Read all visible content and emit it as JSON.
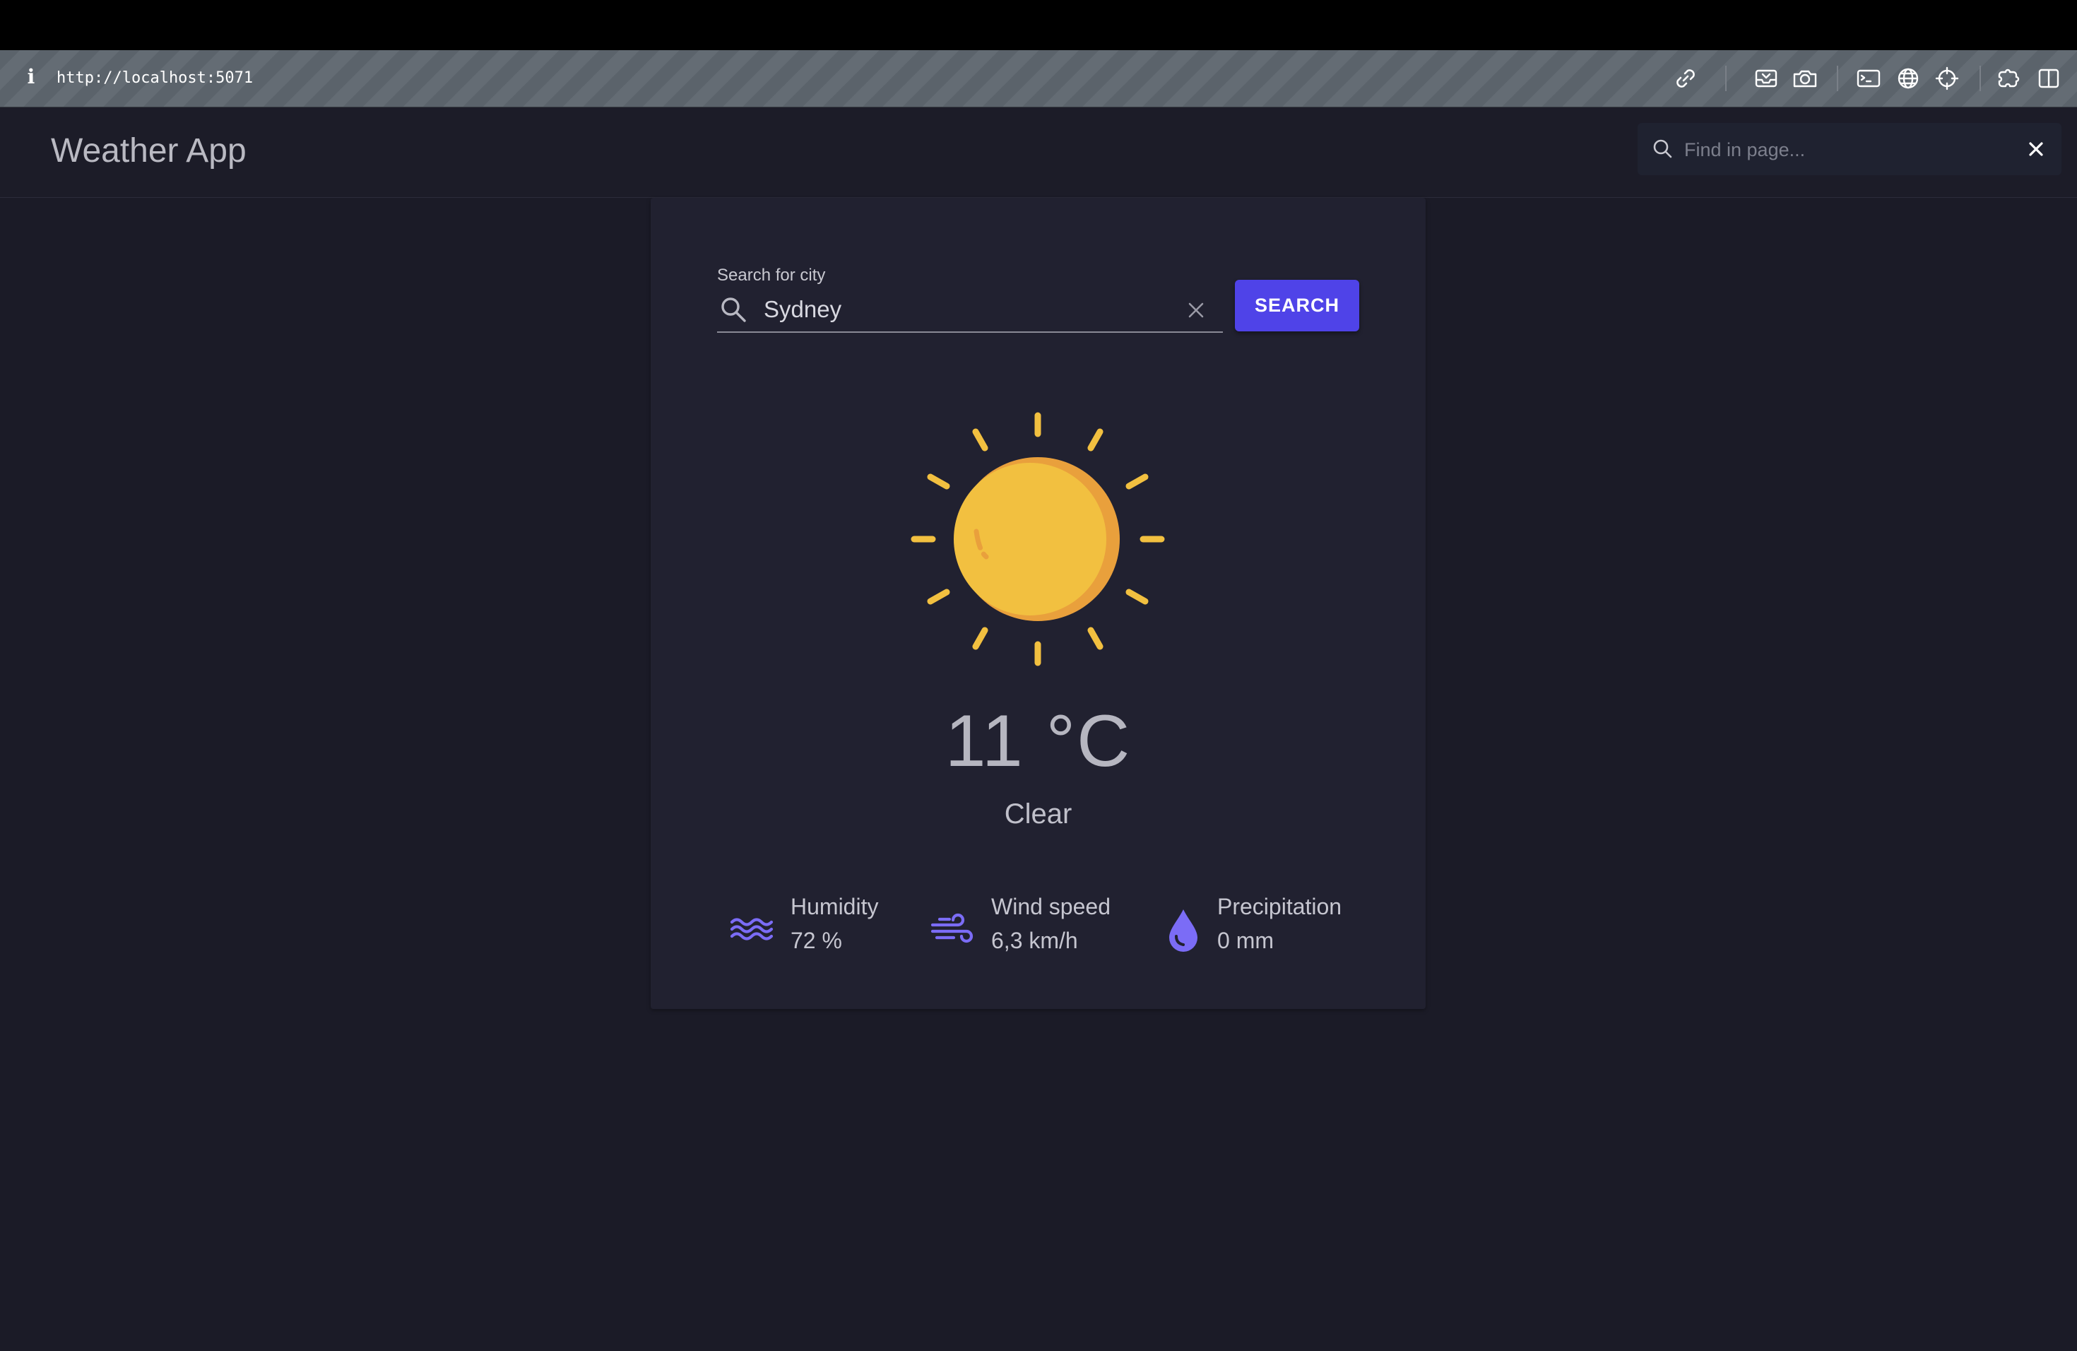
{
  "browser": {
    "url": "http://localhost:5071",
    "icons": [
      "info-icon",
      "link-icon",
      "inbox-icon",
      "camera-icon",
      "terminal-icon",
      "globe-icon",
      "crosshair-icon",
      "extensions-icon",
      "split-view-icon"
    ]
  },
  "app": {
    "title": "Weather App"
  },
  "find": {
    "placeholder": "Find in page..."
  },
  "search": {
    "label": "Search for city",
    "value": "Sydney",
    "button_label": "SEARCH"
  },
  "weather": {
    "icon": "sun-icon",
    "temperature": "11 °C",
    "description": "Clear",
    "humidity": {
      "label": "Humidity",
      "value": "72 %"
    },
    "wind": {
      "label": "Wind speed",
      "value": "6,3 km/h"
    },
    "precipitation": {
      "label": "Precipitation",
      "value": "0 mm"
    }
  },
  "colors": {
    "accent": "#4f43e8",
    "sun": "#f2c040",
    "sun_shade": "#e9a03c",
    "icon_purple": "#7b6cf6",
    "background": "#1b1b27",
    "card": "#212130"
  }
}
